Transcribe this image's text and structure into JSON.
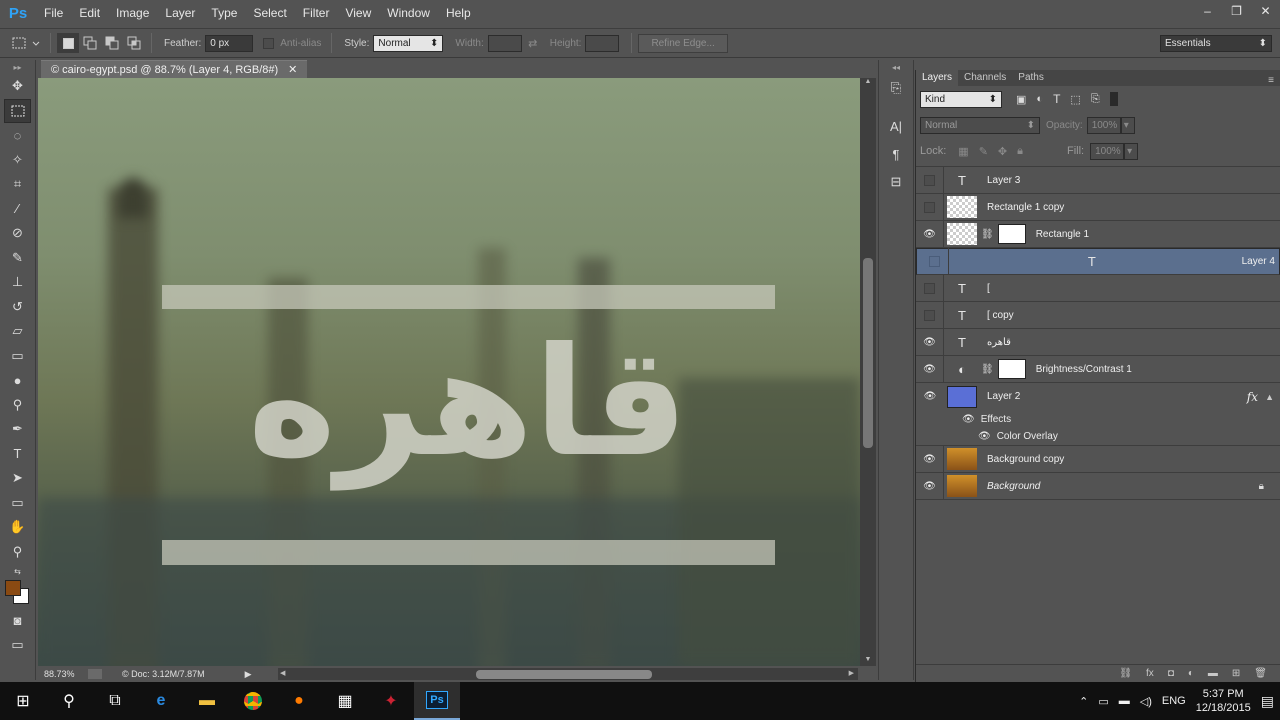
{
  "app": {
    "logo": "Ps",
    "window_controls": [
      "–",
      "❐",
      "✕"
    ]
  },
  "menu": [
    "File",
    "Edit",
    "Image",
    "Layer",
    "Type",
    "Select",
    "Filter",
    "View",
    "Window",
    "Help"
  ],
  "options": {
    "feather_label": "Feather:",
    "feather_value": "0 px",
    "antialias_label": "Anti-alias",
    "style_label": "Style:",
    "style_value": "Normal",
    "width_label": "Width:",
    "height_label": "Height:",
    "refine_edge": "Refine Edge...",
    "workspace": "Essentials"
  },
  "document": {
    "tab_title": "© cairo-egypt.psd @ 88.7% (Layer 4, RGB/8#)",
    "tab_close": "✕",
    "artwork_text": "قاهره",
    "zoom": "88.73%",
    "doc_info": "© Doc: 3.12M/7.87M"
  },
  "panel": {
    "tabs": [
      "Layers",
      "Channels",
      "Paths"
    ],
    "filter_kind": "Kind",
    "blend_mode": "Normal",
    "opacity_label": "Opacity:",
    "opacity_value": "100%",
    "lock_label": "Lock:",
    "fill_label": "Fill:",
    "fill_value": "100%",
    "layers": [
      {
        "name": "Layer 3",
        "visible": false,
        "kind": "text"
      },
      {
        "name": "Rectangle 1 copy",
        "visible": false,
        "kind": "shape"
      },
      {
        "name": "Rectangle 1",
        "visible": true,
        "kind": "shape-mask"
      },
      {
        "name": "Layer 4",
        "visible": false,
        "kind": "text",
        "selected": true
      },
      {
        "name": "[",
        "visible": false,
        "kind": "text"
      },
      {
        "name": "[ copy",
        "visible": false,
        "kind": "text"
      },
      {
        "name": "قاهره",
        "visible": true,
        "kind": "text"
      },
      {
        "name": "Brightness/Contrast 1",
        "visible": true,
        "kind": "adjustment"
      },
      {
        "name": "Layer 2",
        "visible": true,
        "kind": "fill",
        "fx": "fx"
      },
      {
        "name": "Background copy",
        "visible": true,
        "kind": "image"
      },
      {
        "name": "Background",
        "visible": true,
        "kind": "image",
        "locked": true
      }
    ],
    "effects_label": "Effects",
    "color_overlay_label": "Color Overlay"
  },
  "taskbar": {
    "lang": "ENG",
    "time": "5:37 PM",
    "date": "12/18/2015"
  },
  "colors": {
    "foreground": "#8a4a12",
    "background": "#ffffff",
    "selection": "#5b6f8e",
    "layer2_fill": "#5a6fd6"
  }
}
